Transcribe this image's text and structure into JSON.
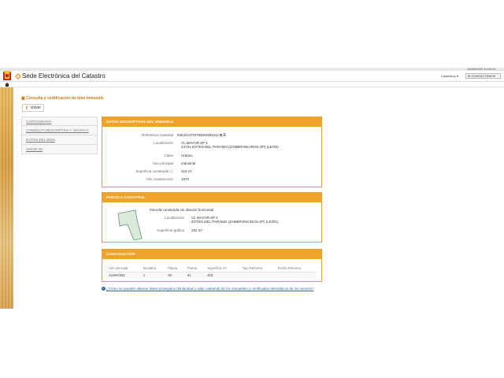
{
  "datetime": "06/05/2020  10:09:01",
  "header": {
    "title": "Sede Electrónica del Catastro",
    "language": "Castellano ▾",
    "contact": "CONTÁCTENOS"
  },
  "page": {
    "title": "Consulta y certificación de bien inmueble",
    "back_label": "Volver"
  },
  "sidemenu": [
    {
      "label": "CARTOGRAFÍA"
    },
    {
      "label": "CONSULTA DESCRIPTIVA Y GRÁFICA"
    },
    {
      "label": "DATOS DEL BIEN"
    },
    {
      "label": "VISOR 3D"
    }
  ],
  "inmueble": {
    "header": "DATOS DESCRIPTIVOS DEL INMUEBLE",
    "fields": [
      {
        "label": "Referencia catastral",
        "value": "6364214TM7846S0001HJ"
      },
      {
        "label": "Localización",
        "value": "CL MAYOR ZP 4",
        "value2": "24791 ZOTES DEL PARAMO (ZAMBRONCINOS-ZP) (LEÓN)"
      },
      {
        "label": "Clase",
        "value": "Urbano"
      },
      {
        "label": "Uso principal",
        "value": "Industrial"
      },
      {
        "label": "Superficie construida",
        "value": "419 m²"
      },
      {
        "label": "Año construcción",
        "value": "1970"
      }
    ]
  },
  "parcela": {
    "header": "PARCELA CATASTRAL",
    "description": "Parcela construida sin división horizontal",
    "loc_label": "Localización",
    "loc_value": "CL MAYOR ZP 4",
    "loc_value2": "ZOTES DEL PARAMO (ZAMBRONCINOS-ZP) (LEÓN)",
    "surface_label": "Superficie gráfica",
    "surface_value": "432 m²"
  },
  "construccion": {
    "header": "CONSTRUCCIÓN",
    "columns": [
      "Uso principal",
      "Escalera",
      "Planta",
      "Puerta",
      "Superficie m²",
      "Tipo Reforma",
      "Fecha Reforma"
    ],
    "rows": [
      [
        "ALMACEN",
        "1",
        "00",
        "01",
        "419",
        "",
        ""
      ]
    ]
  },
  "info_link": "¿Cómo se pueden obtener datos protegidos (titularidad y valor catastral) de los inmuebles y certificados telemáticos de los mismos?",
  "colors": {
    "accent": "#f0a32a",
    "title": "#c8771a",
    "link": "#3366aa"
  }
}
